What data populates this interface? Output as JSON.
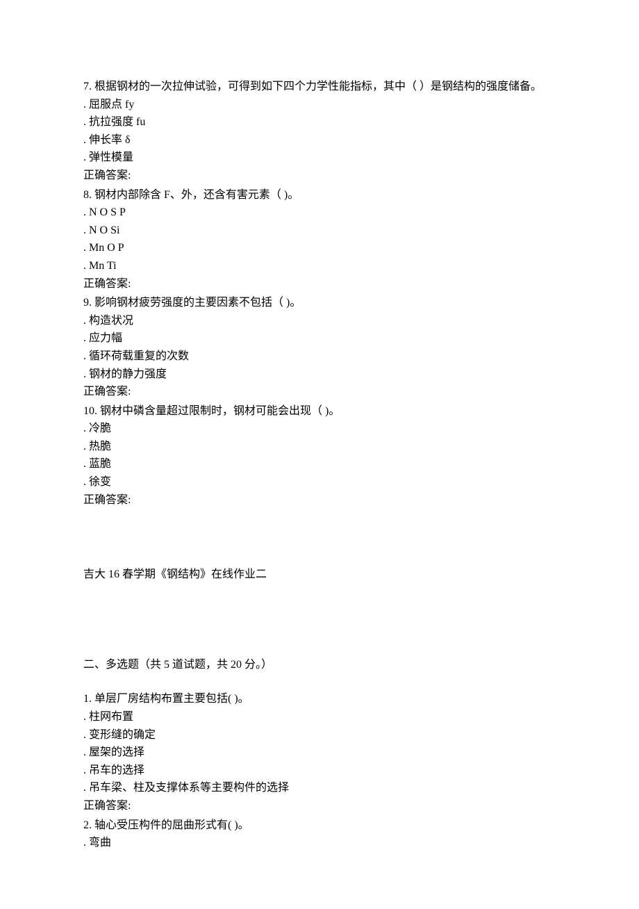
{
  "section1": {
    "questions": [
      {
        "num": "7.",
        "text": "根据钢材的一次拉伸试验，可得到如下四个力学性能指标，其中（ ）是钢结构的强度储备。",
        "options": [
          ". 屈服点 fy",
          ". 抗拉强度 fu",
          ". 伸长率 δ",
          ". 弹性模量"
        ],
        "answer_label": "正确答案:"
      },
      {
        "num": "8.",
        "text": "钢材内部除含 F、外，还含有害元素（ )。",
        "options": [
          ". N O S P",
          ". N O Si",
          ". Mn O P",
          ". Mn Ti"
        ],
        "answer_label": "正确答案:"
      },
      {
        "num": "9.",
        "text": "影响钢材疲劳强度的主要因素不包括（ )。",
        "options": [
          ". 构造状况",
          ". 应力幅",
          ". 循环荷载重复的次数",
          ". 钢材的静力强度"
        ],
        "answer_label": "正确答案:"
      },
      {
        "num": "10.",
        "text": "钢材中磷含量超过限制时，钢材可能会出现（ )。",
        "options": [
          ". 冷脆",
          ". 热脆",
          ". 蓝脆",
          ". 徐变"
        ],
        "answer_label": "正确答案:"
      }
    ]
  },
  "divider_title": "吉大 16 春学期《钢结构》在线作业二",
  "section2_header": "二、多选题（共 5 道试题，共 20 分。）",
  "section2": {
    "questions": [
      {
        "num": "1.",
        "text": "单层厂房结构布置主要包括( )。",
        "options": [
          ". 柱网布置",
          ". 变形缝的确定",
          ". 屋架的选择",
          ". 吊车的选择",
          ". 吊车梁、柱及支撑体系等主要构件的选择"
        ],
        "answer_label": "正确答案:"
      },
      {
        "num": "2.",
        "text": "轴心受压构件的屈曲形式有( )。",
        "options": [
          ". 弯曲"
        ],
        "answer_label": ""
      }
    ]
  }
}
